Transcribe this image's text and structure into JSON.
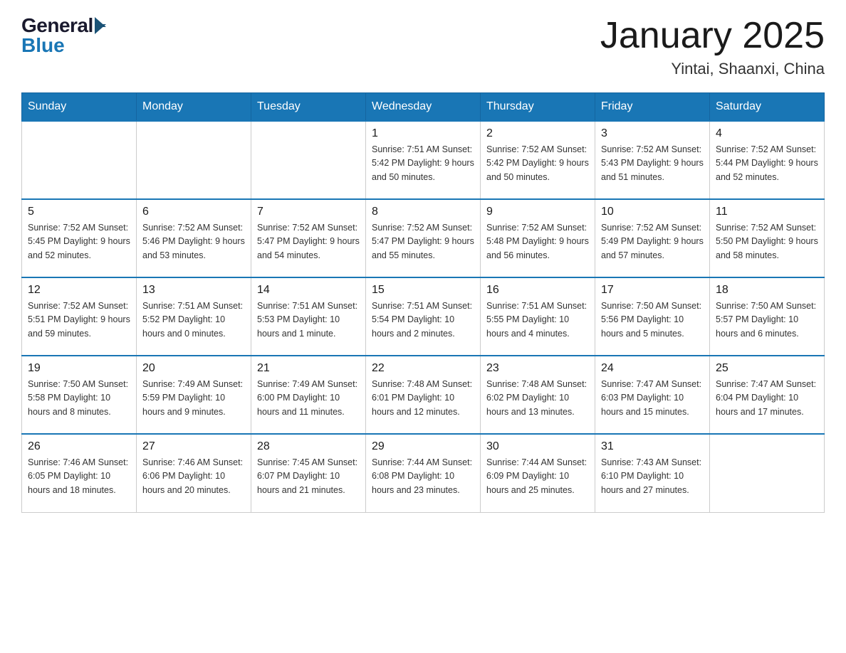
{
  "logo": {
    "general": "General",
    "blue": "Blue"
  },
  "title": "January 2025",
  "subtitle": "Yintai, Shaanxi, China",
  "days_of_week": [
    "Sunday",
    "Monday",
    "Tuesday",
    "Wednesday",
    "Thursday",
    "Friday",
    "Saturday"
  ],
  "weeks": [
    [
      {
        "day": "",
        "info": ""
      },
      {
        "day": "",
        "info": ""
      },
      {
        "day": "",
        "info": ""
      },
      {
        "day": "1",
        "info": "Sunrise: 7:51 AM\nSunset: 5:42 PM\nDaylight: 9 hours and 50 minutes."
      },
      {
        "day": "2",
        "info": "Sunrise: 7:52 AM\nSunset: 5:42 PM\nDaylight: 9 hours and 50 minutes."
      },
      {
        "day": "3",
        "info": "Sunrise: 7:52 AM\nSunset: 5:43 PM\nDaylight: 9 hours and 51 minutes."
      },
      {
        "day": "4",
        "info": "Sunrise: 7:52 AM\nSunset: 5:44 PM\nDaylight: 9 hours and 52 minutes."
      }
    ],
    [
      {
        "day": "5",
        "info": "Sunrise: 7:52 AM\nSunset: 5:45 PM\nDaylight: 9 hours and 52 minutes."
      },
      {
        "day": "6",
        "info": "Sunrise: 7:52 AM\nSunset: 5:46 PM\nDaylight: 9 hours and 53 minutes."
      },
      {
        "day": "7",
        "info": "Sunrise: 7:52 AM\nSunset: 5:47 PM\nDaylight: 9 hours and 54 minutes."
      },
      {
        "day": "8",
        "info": "Sunrise: 7:52 AM\nSunset: 5:47 PM\nDaylight: 9 hours and 55 minutes."
      },
      {
        "day": "9",
        "info": "Sunrise: 7:52 AM\nSunset: 5:48 PM\nDaylight: 9 hours and 56 minutes."
      },
      {
        "day": "10",
        "info": "Sunrise: 7:52 AM\nSunset: 5:49 PM\nDaylight: 9 hours and 57 minutes."
      },
      {
        "day": "11",
        "info": "Sunrise: 7:52 AM\nSunset: 5:50 PM\nDaylight: 9 hours and 58 minutes."
      }
    ],
    [
      {
        "day": "12",
        "info": "Sunrise: 7:52 AM\nSunset: 5:51 PM\nDaylight: 9 hours and 59 minutes."
      },
      {
        "day": "13",
        "info": "Sunrise: 7:51 AM\nSunset: 5:52 PM\nDaylight: 10 hours and 0 minutes."
      },
      {
        "day": "14",
        "info": "Sunrise: 7:51 AM\nSunset: 5:53 PM\nDaylight: 10 hours and 1 minute."
      },
      {
        "day": "15",
        "info": "Sunrise: 7:51 AM\nSunset: 5:54 PM\nDaylight: 10 hours and 2 minutes."
      },
      {
        "day": "16",
        "info": "Sunrise: 7:51 AM\nSunset: 5:55 PM\nDaylight: 10 hours and 4 minutes."
      },
      {
        "day": "17",
        "info": "Sunrise: 7:50 AM\nSunset: 5:56 PM\nDaylight: 10 hours and 5 minutes."
      },
      {
        "day": "18",
        "info": "Sunrise: 7:50 AM\nSunset: 5:57 PM\nDaylight: 10 hours and 6 minutes."
      }
    ],
    [
      {
        "day": "19",
        "info": "Sunrise: 7:50 AM\nSunset: 5:58 PM\nDaylight: 10 hours and 8 minutes."
      },
      {
        "day": "20",
        "info": "Sunrise: 7:49 AM\nSunset: 5:59 PM\nDaylight: 10 hours and 9 minutes."
      },
      {
        "day": "21",
        "info": "Sunrise: 7:49 AM\nSunset: 6:00 PM\nDaylight: 10 hours and 11 minutes."
      },
      {
        "day": "22",
        "info": "Sunrise: 7:48 AM\nSunset: 6:01 PM\nDaylight: 10 hours and 12 minutes."
      },
      {
        "day": "23",
        "info": "Sunrise: 7:48 AM\nSunset: 6:02 PM\nDaylight: 10 hours and 13 minutes."
      },
      {
        "day": "24",
        "info": "Sunrise: 7:47 AM\nSunset: 6:03 PM\nDaylight: 10 hours and 15 minutes."
      },
      {
        "day": "25",
        "info": "Sunrise: 7:47 AM\nSunset: 6:04 PM\nDaylight: 10 hours and 17 minutes."
      }
    ],
    [
      {
        "day": "26",
        "info": "Sunrise: 7:46 AM\nSunset: 6:05 PM\nDaylight: 10 hours and 18 minutes."
      },
      {
        "day": "27",
        "info": "Sunrise: 7:46 AM\nSunset: 6:06 PM\nDaylight: 10 hours and 20 minutes."
      },
      {
        "day": "28",
        "info": "Sunrise: 7:45 AM\nSunset: 6:07 PM\nDaylight: 10 hours and 21 minutes."
      },
      {
        "day": "29",
        "info": "Sunrise: 7:44 AM\nSunset: 6:08 PM\nDaylight: 10 hours and 23 minutes."
      },
      {
        "day": "30",
        "info": "Sunrise: 7:44 AM\nSunset: 6:09 PM\nDaylight: 10 hours and 25 minutes."
      },
      {
        "day": "31",
        "info": "Sunrise: 7:43 AM\nSunset: 6:10 PM\nDaylight: 10 hours and 27 minutes."
      },
      {
        "day": "",
        "info": ""
      }
    ]
  ]
}
